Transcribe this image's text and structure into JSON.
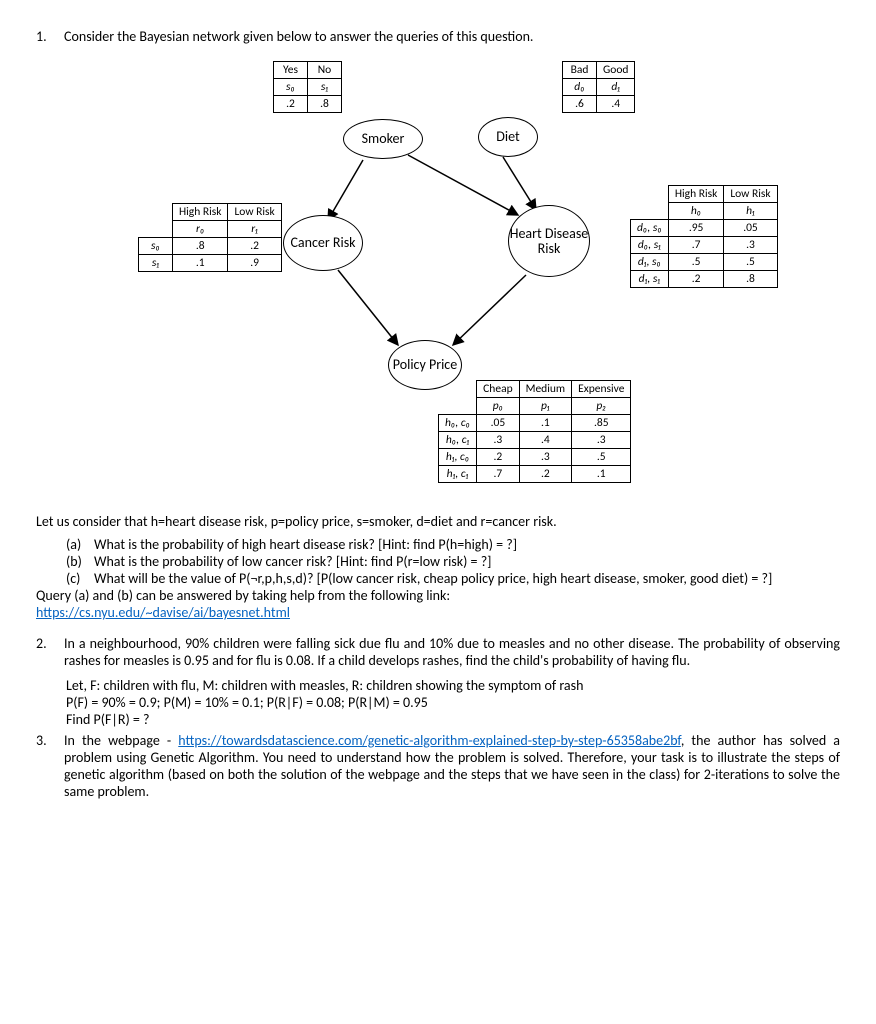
{
  "q1": {
    "num": "1.",
    "intro": "Consider the Bayesian network given below to answer the queries of this question."
  },
  "diagram": {
    "nodes": {
      "smoker": "Smoker",
      "diet": "Diet",
      "cancer": "Cancer Risk",
      "heart": "Heart Disease Risk",
      "policy": "Policy Price"
    },
    "smoker_tbl": {
      "h1": "Yes",
      "h2": "No",
      "s1": "s₀",
      "s2": "s₁",
      "v1": ".2",
      "v2": ".8"
    },
    "diet_tbl": {
      "h1": "Bad",
      "h2": "Good",
      "s1": "d₀",
      "s2": "d₁",
      "v1": ".6",
      "v2": ".4"
    },
    "cancer_tbl": {
      "h1": "High Risk",
      "h2": "Low Risk",
      "s1": "r₀",
      "s2": "r₁",
      "r1": "s₀",
      "r1v1": ".8",
      "r1v2": ".2",
      "r2": "s₁",
      "r2v1": ".1",
      "r2v2": ".9"
    },
    "heart_tbl": {
      "h1": "High Risk",
      "h2": "Low Risk",
      "s1": "h₀",
      "s2": "h₁",
      "r1": "d₀, s₀",
      "r1v1": ".95",
      "r1v2": ".05",
      "r2": "d₀, s₁",
      "r2v1": ".7",
      "r2v2": ".3",
      "r3": "d₁, s₀",
      "r3v1": ".5",
      "r3v2": ".5",
      "r4": "d₁, s₁",
      "r4v1": ".2",
      "r4v2": ".8"
    },
    "policy_tbl": {
      "h1": "Cheap",
      "h2": "Medium",
      "h3": "Expensive",
      "s1": "p₀",
      "s2": "p₁",
      "s3": "p₂",
      "r1": "h₀, c₀",
      "r1v1": ".05",
      "r1v2": ".1",
      "r1v3": ".85",
      "r2": "h₀, c₁",
      "r2v1": ".3",
      "r2v2": ".4",
      "r2v3": ".3",
      "r3": "h₁, c₀",
      "r3v1": ".2",
      "r3v2": ".3",
      "r3v3": ".5",
      "r4": "h₁, c₁",
      "r4v1": ".7",
      "r4v2": ".2",
      "r4v3": ".1"
    }
  },
  "q1_body": {
    "consider": "Let us consider that h=heart disease risk, p=policy price, s=smoker, d=diet and r=cancer risk.",
    "a_letter": "(a)",
    "a": "What is the probability of high heart disease risk? [Hint: find P(h=high) = ?]",
    "b_letter": "(b)",
    "b": "What is the probability of low cancer risk? [Hint: find P(r=low risk) = ?]",
    "c_letter": "(c)",
    "c": "What will be the value of P(¬r,p,h,s,d)? [P(low cancer risk, cheap policy price, high heart disease, smoker, good diet) = ?]",
    "query_note": "Query (a) and (b) can be answered by taking help from the following link:",
    "link": "https://cs.nyu.edu/~davise/ai/bayesnet.html"
  },
  "q2": {
    "num": "2.",
    "p1": "In a neighbourhood, 90% children were falling sick due flu and 10% due to measles and no other disease. The probability of observing rashes for measles is 0.95 and for flu is 0.08. If a child develops rashes, find the child's probability of having flu.",
    "p2": "Let, F: children with flu, M: children with measles, R: children showing the symptom of rash",
    "p3": "P(F) = 90% = 0.9; P(M) = 10% = 0.1; P(R|F) = 0.08; P(R|M) = 0.95",
    "p4": "Find P(F|R) = ?"
  },
  "q3": {
    "num": "3.",
    "pre": "In the webpage - ",
    "link": "https://towardsdatascience.com/genetic-algorithm-explained-step-by-step-65358abe2bf",
    "post": ", the author has solved a problem using Genetic Algorithm. You need to understand how the problem is solved. Therefore, your task is to illustrate the steps of genetic algorithm (based on both the solution of the webpage and the steps that we have seen in the class) for 2-iterations to solve the same problem."
  }
}
